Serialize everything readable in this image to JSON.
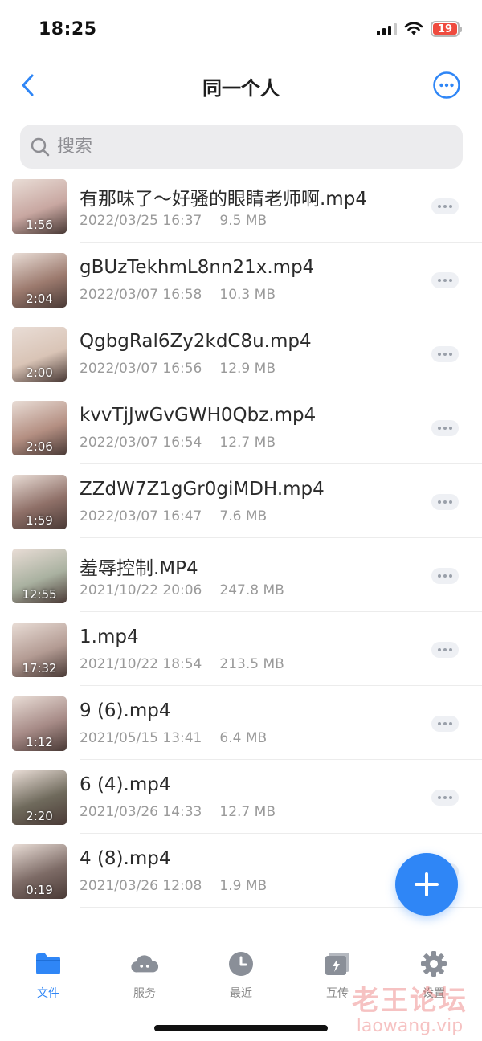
{
  "status_bar": {
    "time": "18:25",
    "battery": "19"
  },
  "nav": {
    "title": "同一个人"
  },
  "search": {
    "placeholder": "搜索"
  },
  "files": [
    {
      "name": "有那味了～好骚的眼睛老师啊.mp4",
      "date": "2022/03/25 16:37",
      "size": "9.5 MB",
      "duration": "1:56",
      "thumb_color": "#c8a7a1"
    },
    {
      "name": "gBUzTekhmL8nn21x.mp4",
      "date": "2022/03/07 16:58",
      "size": "10.3 MB",
      "duration": "2:04",
      "thumb_color": "#9c7a6e"
    },
    {
      "name": "QgbgRal6Zy2kdC8u.mp4",
      "date": "2022/03/07 16:56",
      "size": "12.9 MB",
      "duration": "2:00",
      "thumb_color": "#d9c4b6"
    },
    {
      "name": "kvvTjJwGvGWH0Qbz.mp4",
      "date": "2022/03/07 16:54",
      "size": "12.7 MB",
      "duration": "2:06",
      "thumb_color": "#b48f82"
    },
    {
      "name": "ZZdW7Z1gGr0giMDH.mp4",
      "date": "2022/03/07 16:47",
      "size": "7.6 MB",
      "duration": "1:59",
      "thumb_color": "#8f7068"
    },
    {
      "name": "羞辱控制.MP4",
      "date": "2021/10/22 20:06",
      "size": "247.8 MB",
      "duration": "12:55",
      "thumb_color": "#a9b1a0"
    },
    {
      "name": "1.mp4",
      "date": "2021/10/22 18:54",
      "size": "213.5 MB",
      "duration": "17:32",
      "thumb_color": "#b39b93"
    },
    {
      "name": "9 (6).mp4",
      "date": "2021/05/15 13:41",
      "size": "6.4 MB",
      "duration": "1:12",
      "thumb_color": "#a68a86"
    },
    {
      "name": "6 (4).mp4",
      "date": "2021/03/26 14:33",
      "size": "12.7 MB",
      "duration": "2:20",
      "thumb_color": "#6f6a5c"
    },
    {
      "name": "4 (8).mp4",
      "date": "2021/03/26 12:08",
      "size": "1.9 MB",
      "duration": "0:19",
      "thumb_color": "#7d6b66"
    }
  ],
  "tabs": [
    {
      "label": "文件",
      "icon": "folder-icon",
      "active": true
    },
    {
      "label": "服务",
      "icon": "cloud-icon",
      "active": false
    },
    {
      "label": "最近",
      "icon": "clock-icon",
      "active": false
    },
    {
      "label": "互传",
      "icon": "transfer-icon",
      "active": false
    },
    {
      "label": "设置",
      "icon": "gear-icon",
      "active": false
    }
  ],
  "watermark": {
    "line1": "老王论坛",
    "line2": "laowang.vip"
  },
  "colors": {
    "accent": "#2f86f6",
    "tab_inactive": "#8a8a8a"
  }
}
